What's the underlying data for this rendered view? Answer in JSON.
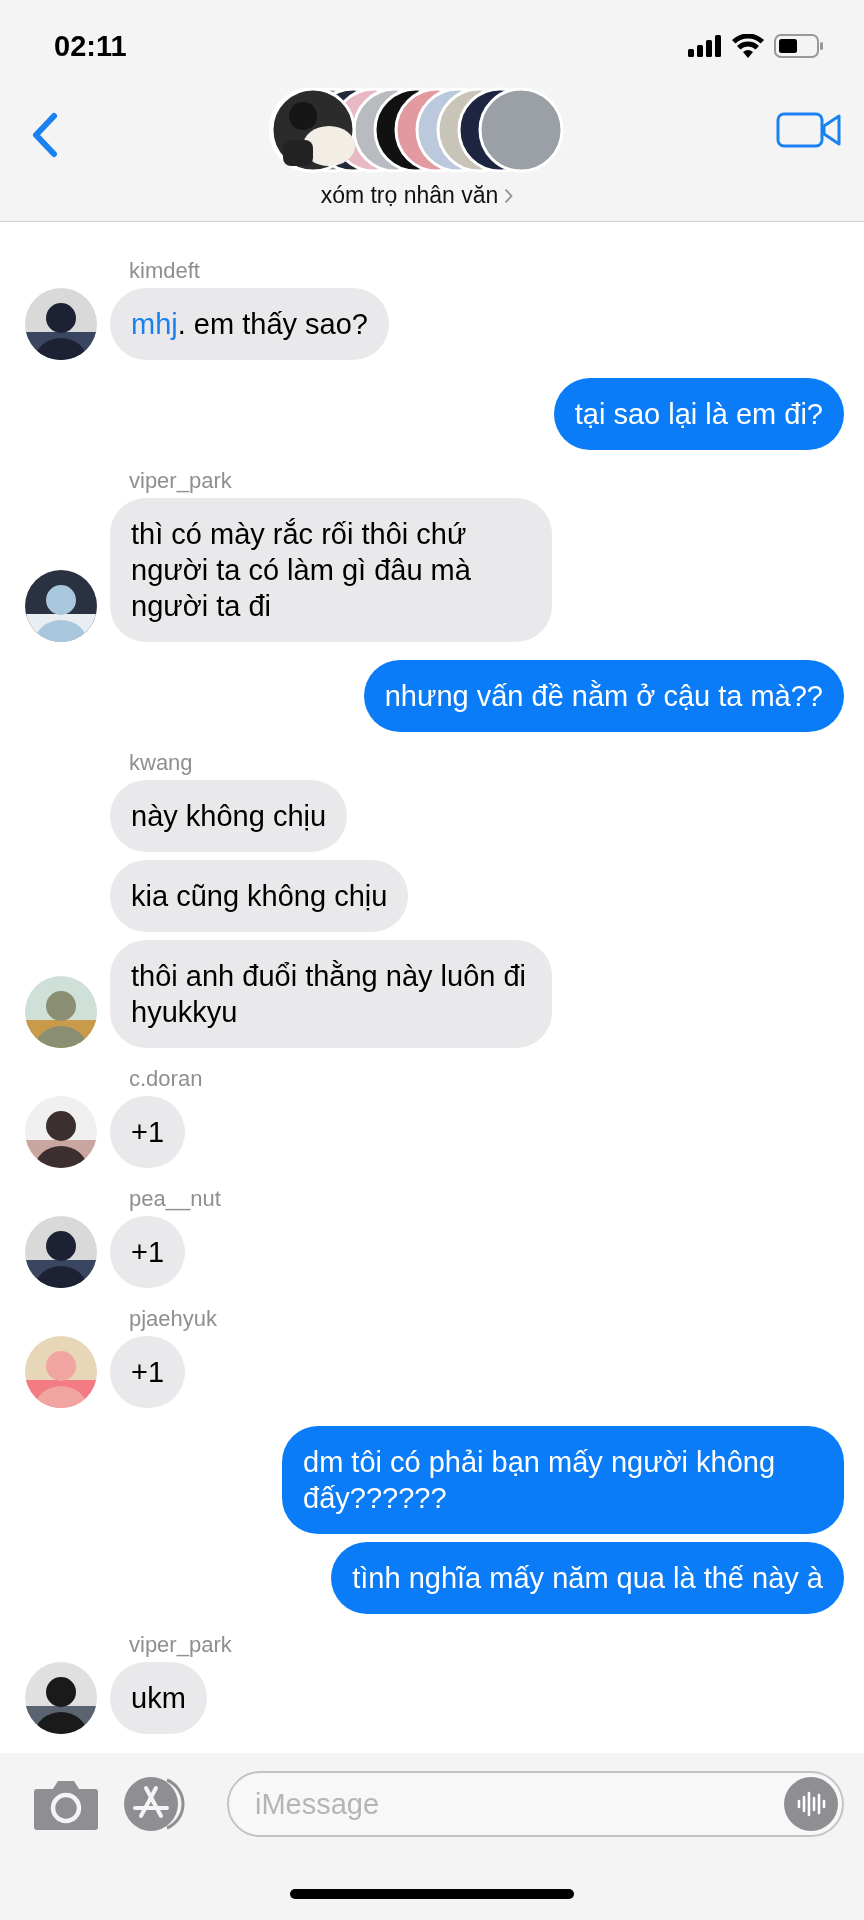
{
  "status_bar": {
    "time": "02:11"
  },
  "header": {
    "title": "xóm trọ nhân văn"
  },
  "messages": [
    {
      "kind": "received",
      "sender": "kimdeft",
      "bubbles": [
        {
          "mention": "mhj",
          "text": ". em thấy sao?"
        }
      ]
    },
    {
      "kind": "sent",
      "bubbles": [
        {
          "text": "tại sao lại là em đi?"
        }
      ]
    },
    {
      "kind": "received",
      "sender": "viper_park",
      "bubbles": [
        {
          "text": "thì có mày rắc rối thôi chứ người ta có làm gì đâu mà người ta đi"
        }
      ]
    },
    {
      "kind": "sent",
      "bubbles": [
        {
          "text": "nhưng vấn đề nằm ở cậu ta mà??"
        }
      ]
    },
    {
      "kind": "received",
      "sender": "kwang",
      "bubbles": [
        {
          "text": "này không chịu"
        },
        {
          "text": "kia cũng không chịu"
        },
        {
          "text": "thôi anh đuổi thằng này luôn đi hyukkyu"
        }
      ]
    },
    {
      "kind": "received",
      "sender": "c.doran",
      "bubbles": [
        {
          "text": "+1"
        }
      ]
    },
    {
      "kind": "received",
      "sender": "pea__nut",
      "bubbles": [
        {
          "text": "+1"
        }
      ]
    },
    {
      "kind": "received",
      "sender": "pjaehyuk",
      "bubbles": [
        {
          "text": "+1"
        }
      ]
    },
    {
      "kind": "sent",
      "bubbles": [
        {
          "text": "dm tôi có phải bạn mấy người không đấy??????"
        },
        {
          "text": "tình nghĩa mấy năm qua là thế này à"
        }
      ]
    },
    {
      "kind": "received",
      "sender": "viper_park",
      "bubbles": [
        {
          "text": "ukm"
        }
      ]
    }
  ],
  "composer": {
    "placeholder": "iMessage"
  }
}
